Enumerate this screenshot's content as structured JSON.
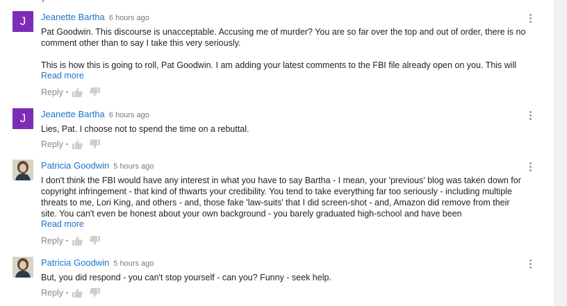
{
  "comments": [
    {
      "author": "Jeanette Bartha",
      "time": "6 hours ago",
      "avatar_letter": "J",
      "paragraphs": [
        "Pat Goodwin. This discourse is unacceptable. Accusing me of murder? You are so far over the top and out of order, there is no comment other than to say I take this very seriously.",
        "This is how this is going to roll, Pat Goodwin. I am adding your latest comments to the FBI file already open on you. This will"
      ],
      "read_more": "Read more",
      "reply": "Reply"
    },
    {
      "author": "Jeanette Bartha",
      "time": "6 hours ago",
      "avatar_letter": "J",
      "paragraphs": [
        "Lies, Pat. I choose not to spend the time on a rebuttal."
      ],
      "reply": "Reply"
    },
    {
      "author": "Patricia Goodwin",
      "time": "5 hours ago",
      "paragraphs": [
        "I don't think the FBI would have any interest in what you have to say Bartha - I mean, your 'previous' blog was taken down for copyright infringement - that kind of thwarts your credibility.  You tend to take everything far too seriously - including multiple threats to me, Lori King, and others - and, those fake 'law-suits' that I did screen-shot - and, Amazon did remove from their site.  You can't even be honest about your own background - you barely graduated high-school and have been"
      ],
      "read_more": "Read more",
      "reply": "Reply"
    },
    {
      "author": "Patricia Goodwin",
      "time": "5 hours ago",
      "paragraphs": [
        "But, you did respond - you can't stop yourself - can you?  Funny - seek help."
      ],
      "reply": "Reply"
    }
  ],
  "colors": {
    "author_link": "#1a73c9",
    "avatar_letter_bg": "#7b2db5"
  },
  "icons": {
    "like": "thumbs-up-icon",
    "dislike": "thumbs-down-icon",
    "menu": "more-vertical-icon"
  }
}
